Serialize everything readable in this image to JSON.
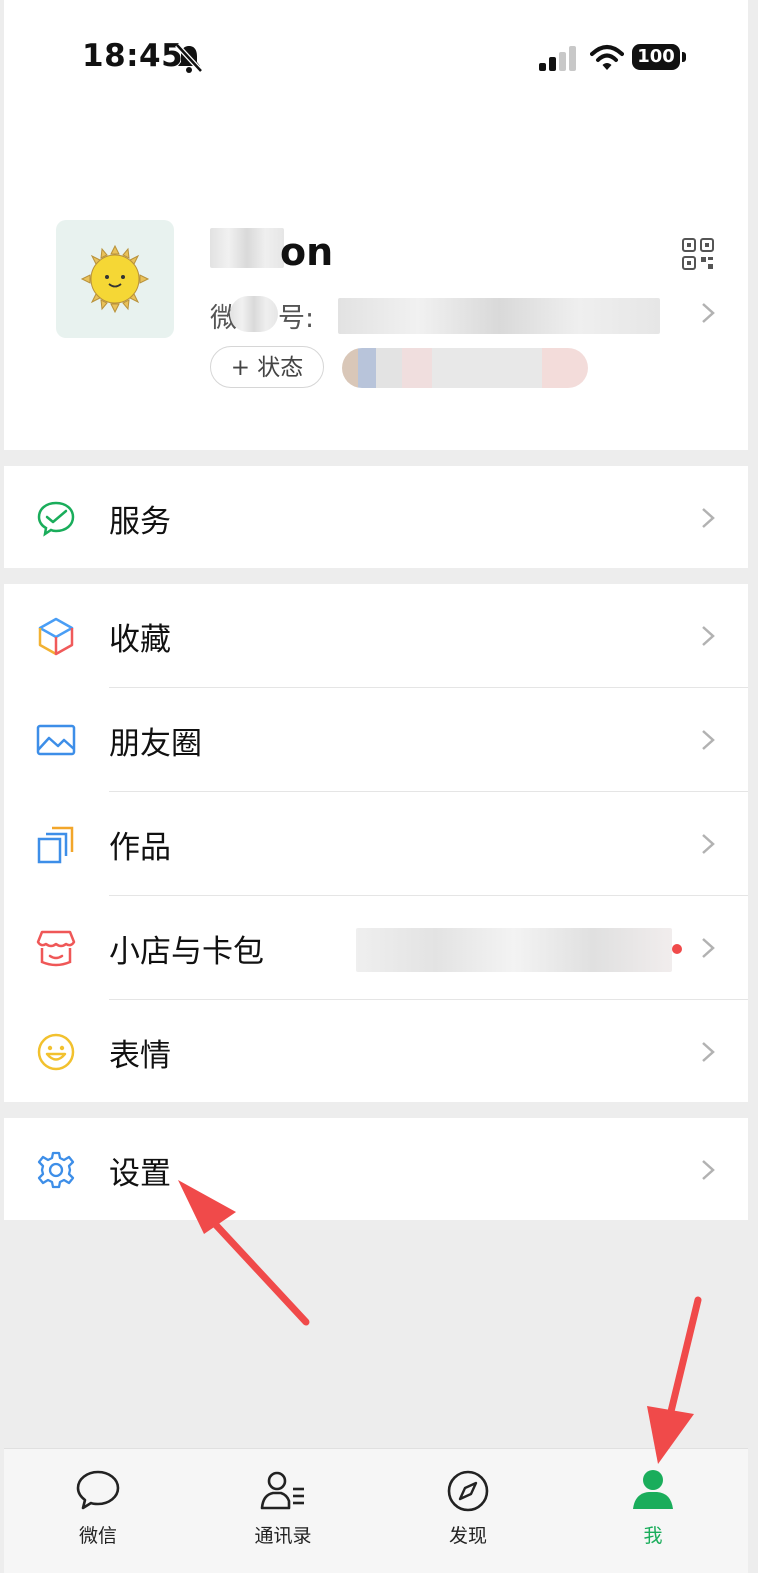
{
  "status_bar": {
    "time": "18:45",
    "battery": "100"
  },
  "profile": {
    "nickname_visible": "on",
    "wechat_id_prefix_a": "微",
    "wechat_id_prefix_b": "号:",
    "status_button": "+ 状态"
  },
  "menu": {
    "service": "服务",
    "favorites": "收藏",
    "moments": "朋友圈",
    "works": "作品",
    "shop_cards": "小店与卡包",
    "stickers": "表情",
    "settings": "设置"
  },
  "tabbar": {
    "items": [
      {
        "label": "微信"
      },
      {
        "label": "通讯录"
      },
      {
        "label": "发现"
      },
      {
        "label": "我"
      }
    ],
    "active_color": "#1aad5b"
  },
  "colors": {
    "accent_green": "#1aad5b",
    "annotation_red": "#f04a4a"
  }
}
